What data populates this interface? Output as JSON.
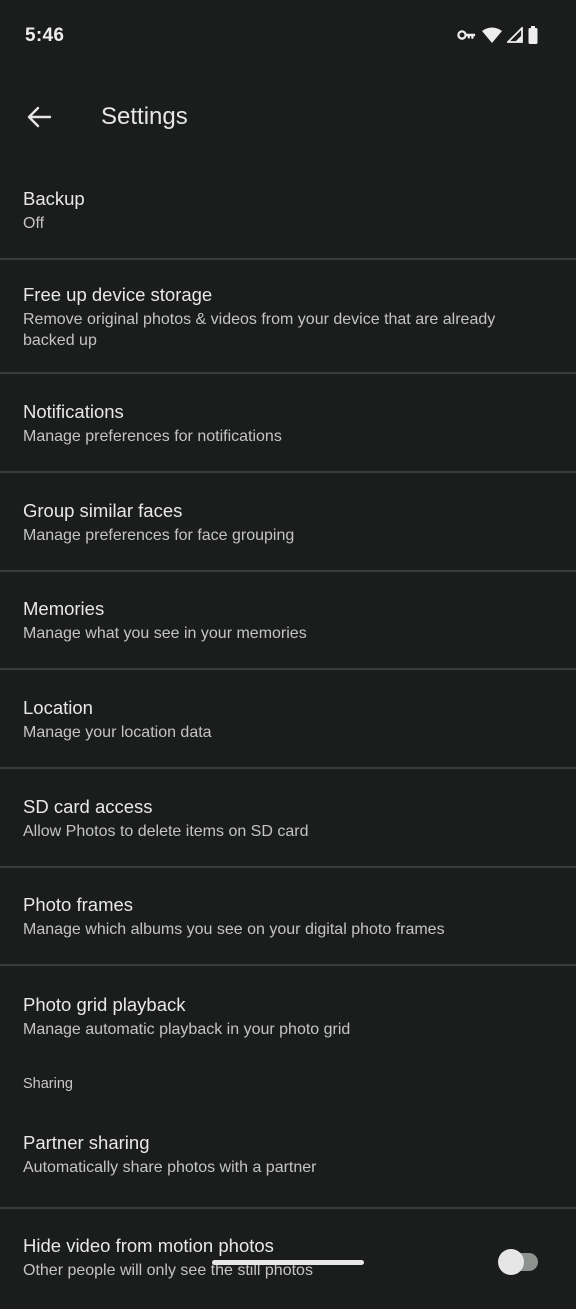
{
  "status_bar": {
    "time": "5:46",
    "icons": [
      "vpn-key-icon",
      "wifi-icon",
      "signal-icon",
      "battery-icon"
    ]
  },
  "app_bar": {
    "back_icon": "arrow-back-icon",
    "title": "Settings"
  },
  "settings": [
    {
      "title": "Backup",
      "subtitle": "Off"
    },
    {
      "title": "Free up device storage",
      "subtitle": "Remove original photos & videos from your device that are already backed up"
    },
    {
      "title": "Notifications",
      "subtitle": "Manage preferences for notifications"
    },
    {
      "title": "Group similar faces",
      "subtitle": "Manage preferences for face grouping"
    },
    {
      "title": "Memories",
      "subtitle": "Manage what you see in your memories"
    },
    {
      "title": "Location",
      "subtitle": "Manage your location data"
    },
    {
      "title": "SD card access",
      "subtitle": "Allow Photos to delete items on SD card"
    },
    {
      "title": "Photo frames",
      "subtitle": "Manage which albums you see on your digital photo frames"
    },
    {
      "title": "Photo grid playback",
      "subtitle": "Manage automatic playback in your photo grid"
    }
  ],
  "sharing_section": {
    "header": "Sharing",
    "items": [
      {
        "title": "Partner sharing",
        "subtitle": "Automatically share photos with a partner"
      },
      {
        "title": "Hide video from motion photos",
        "subtitle": "Other people will only see the still photos",
        "toggle_on": false
      }
    ]
  }
}
